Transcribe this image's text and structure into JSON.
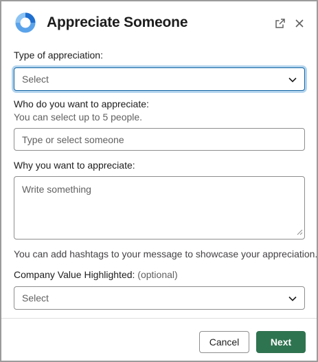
{
  "dialog": {
    "title": "Appreciate Someone",
    "logo_icon": "ring-logo-icon",
    "popout_icon": "external-link-icon",
    "close_icon": "close-icon"
  },
  "form": {
    "appreciation_type": {
      "label": "Type of appreciation:",
      "value": "Select"
    },
    "recipients": {
      "label": "Who do you want to appreciate:",
      "hint": "You can select up to 5 people.",
      "placeholder": "Type or select someone"
    },
    "reason": {
      "label": "Why you want to appreciate:",
      "placeholder": "Write something"
    },
    "hashtag_hint": "You can add hashtags to your message to showcase your appreciation.",
    "company_value": {
      "label": "Company Value Highlighted:",
      "optional": "(optional)",
      "value": "Select"
    }
  },
  "footer": {
    "cancel_label": "Cancel",
    "next_label": "Next"
  },
  "colors": {
    "primary_button": "#2f7450",
    "focus_ring": "#1264a3",
    "logo_blue": "#2e7fd8"
  }
}
